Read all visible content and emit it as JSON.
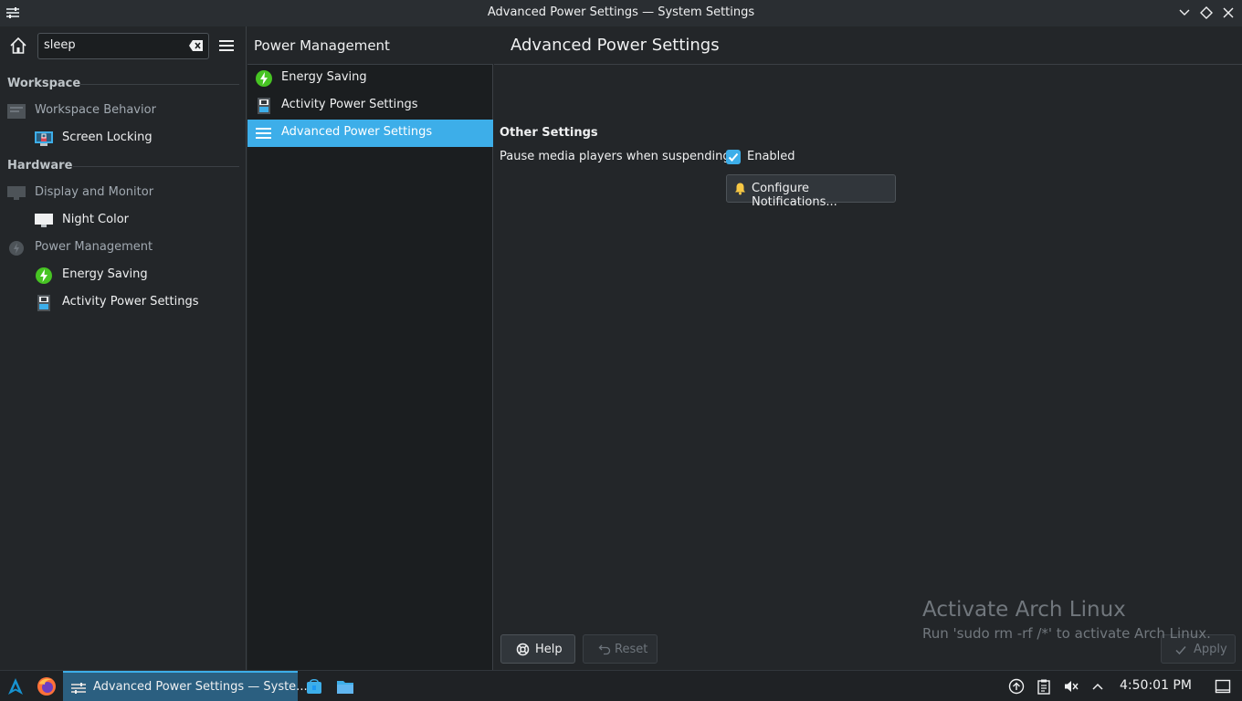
{
  "window": {
    "title": "Advanced Power Settings — System Settings"
  },
  "search": {
    "value": "sleep"
  },
  "sidebar": {
    "sections": [
      {
        "header": "Workspace",
        "items": [
          {
            "label": "Workspace Behavior",
            "icon": "workspace-behavior-icon",
            "level": 1
          },
          {
            "label": "Screen Locking",
            "icon": "screen-locking-icon",
            "level": 2
          }
        ]
      },
      {
        "header": "Hardware",
        "items": [
          {
            "label": "Display and Monitor",
            "icon": "display-monitor-icon",
            "level": 1
          },
          {
            "label": "Night Color",
            "icon": "night-color-icon",
            "level": 2
          },
          {
            "label": "Power Management",
            "icon": "power-management-icon",
            "level": 1
          },
          {
            "label": "Energy Saving",
            "icon": "energy-saving-icon",
            "level": 2
          },
          {
            "label": "Activity Power Settings",
            "icon": "activity-power-icon",
            "level": 2
          }
        ]
      }
    ]
  },
  "middle": {
    "header": "Power Management",
    "items": [
      {
        "label": "Energy Saving",
        "icon": "energy-saving-icon",
        "selected": false
      },
      {
        "label": "Activity Power Settings",
        "icon": "activity-power-icon",
        "selected": false
      },
      {
        "label": "Advanced Power Settings",
        "icon": "hamburger-icon",
        "selected": true
      }
    ]
  },
  "content": {
    "title": "Advanced Power Settings",
    "section": "Other Settings",
    "pause_label": "Pause media players when suspending:",
    "checkbox_label": "Enabled",
    "checkbox_checked": true,
    "configure_button": "Configure Notifications..."
  },
  "footer": {
    "help": "Help",
    "reset": "Reset",
    "apply": "Apply"
  },
  "watermark": {
    "line1": "Activate Arch Linux",
    "line2": "Run 'sudo rm -rf /*' to activate Arch Linux."
  },
  "taskbar": {
    "task_label": "Advanced Power Settings  — Syste...",
    "clock": "4:50:01 PM"
  },
  "colors": {
    "accent": "#3daee9",
    "energy_green": "#47c423",
    "background": "#232629"
  }
}
